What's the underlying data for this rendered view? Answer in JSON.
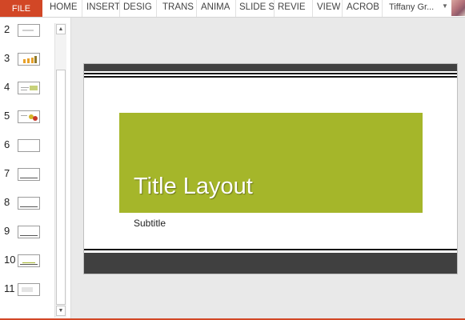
{
  "ribbon": {
    "file_label": "FILE",
    "tabs": [
      "HOME",
      "INSERT",
      "DESIG",
      "TRANS",
      "ANIMA",
      "SLIDE S",
      "REVIE",
      "VIEW",
      "ACROB"
    ],
    "account_name": "Tiffany Gr...",
    "accent_color": "#d24726"
  },
  "thumbnails": {
    "slides": [
      {
        "number": "2"
      },
      {
        "number": "3"
      },
      {
        "number": "4"
      },
      {
        "number": "5"
      },
      {
        "number": "6"
      },
      {
        "number": "7"
      },
      {
        "number": "8"
      },
      {
        "number": "9"
      },
      {
        "number": "10"
      },
      {
        "number": "11"
      }
    ],
    "scroll_up_icon": "triangle-up-icon",
    "scroll_down_icon": "triangle-down-icon"
  },
  "slide": {
    "title": "Title Layout",
    "subtitle": "Subtitle",
    "title_box_color": "#a5b62a",
    "band_color": "#404040"
  }
}
